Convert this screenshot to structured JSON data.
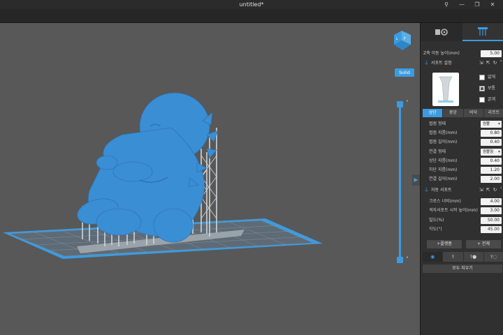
{
  "window": {
    "title": "untitled*",
    "buttons": {
      "account": "⚲",
      "minimize": "—",
      "restore": "❐",
      "close": "✕"
    }
  },
  "viewport": {
    "solid_label": "Solid",
    "model_color": "#3a8ed3",
    "support_color": "#c8ccd0",
    "plate_color": "#3c9be0",
    "slider_up": "˅",
    "slider_down": "˄"
  },
  "panel": {
    "z_height": {
      "label": "Z축 이동 높이(mm)",
      "value": "5.00"
    },
    "support_settings": {
      "title": "서포트 설정"
    },
    "density": [
      {
        "label": "얇게",
        "checked": false
      },
      {
        "label": "보통",
        "checked": true
      },
      {
        "label": "굵게",
        "checked": false
      }
    ],
    "subtabs": [
      "상단",
      "중앙",
      "바닥",
      "라프트"
    ],
    "top_rows": [
      {
        "label": "접점 형태",
        "type": "select",
        "value": "원뿔"
      },
      {
        "label": "접점 지름(mm)",
        "type": "value",
        "value": "0.80"
      },
      {
        "label": "접점 길이(mm)",
        "type": "value",
        "value": "0.40"
      }
    ],
    "connect_rows": [
      {
        "label": "연결 형태",
        "type": "select",
        "value": "원뿔형"
      },
      {
        "label": "상단 지름(mm)",
        "type": "value",
        "value": "0.40"
      },
      {
        "label": "하단 지름(mm)",
        "type": "value",
        "value": "1.20"
      },
      {
        "label": "연결 길이(mm)",
        "type": "value",
        "value": "2.00"
      }
    ],
    "auto_support": {
      "title": "자동 서포트"
    },
    "auto_rows": [
      {
        "label": "크로스 너비(mm)",
        "value": "4.00"
      },
      {
        "label": "격자서포트 시작 높이(mm)",
        "value": "3.00"
      },
      {
        "label": "밀도(%)",
        "value": "50.00"
      },
      {
        "label": "각도(°)",
        "value": "45.00"
      }
    ],
    "add_platform": "+플랫폼",
    "add_all": "+ 전체",
    "clear_all": "모두 지우기"
  }
}
